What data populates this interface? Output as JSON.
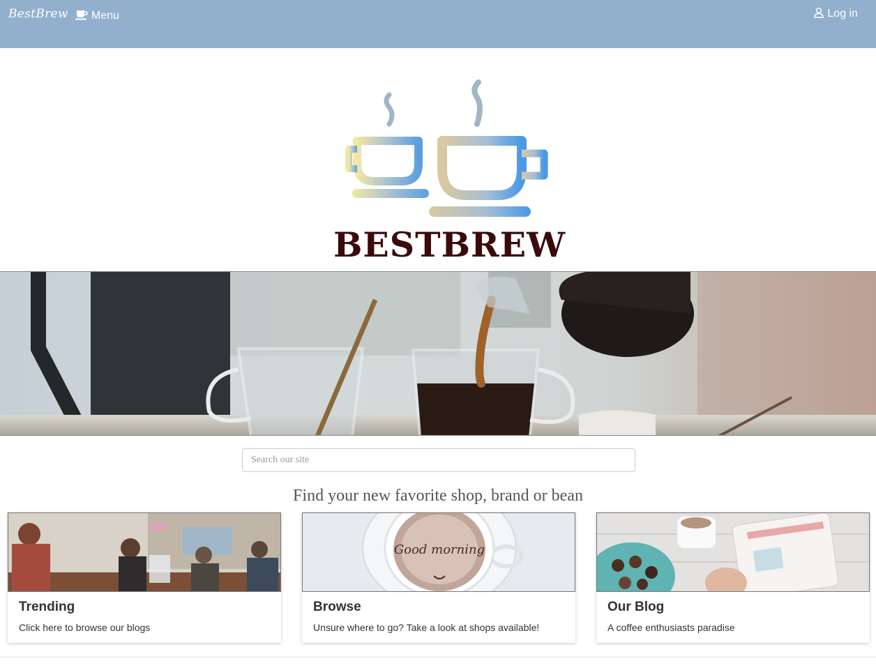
{
  "nav": {
    "brand": "BestBrew",
    "menu_label": "Menu",
    "login_label": "Log in"
  },
  "logo": {
    "wordmark": "BESTBREW"
  },
  "search": {
    "placeholder": "Search our site"
  },
  "tagline": "Find your new favorite shop, brand or bean",
  "cards": [
    {
      "title": "Trending",
      "text": "Click here to browse our blogs"
    },
    {
      "title": "Browse",
      "text": "Unsure where to go? Take a look at shops available!",
      "image_text": "Good morning"
    },
    {
      "title": "Our Blog",
      "text": "A coffee enthusiasts paradise"
    }
  ],
  "colors": {
    "navbar": "#92b0cd",
    "wordmark": "#3a0a0a"
  },
  "icons": [
    "coffee-cup-icon",
    "user-icon"
  ]
}
